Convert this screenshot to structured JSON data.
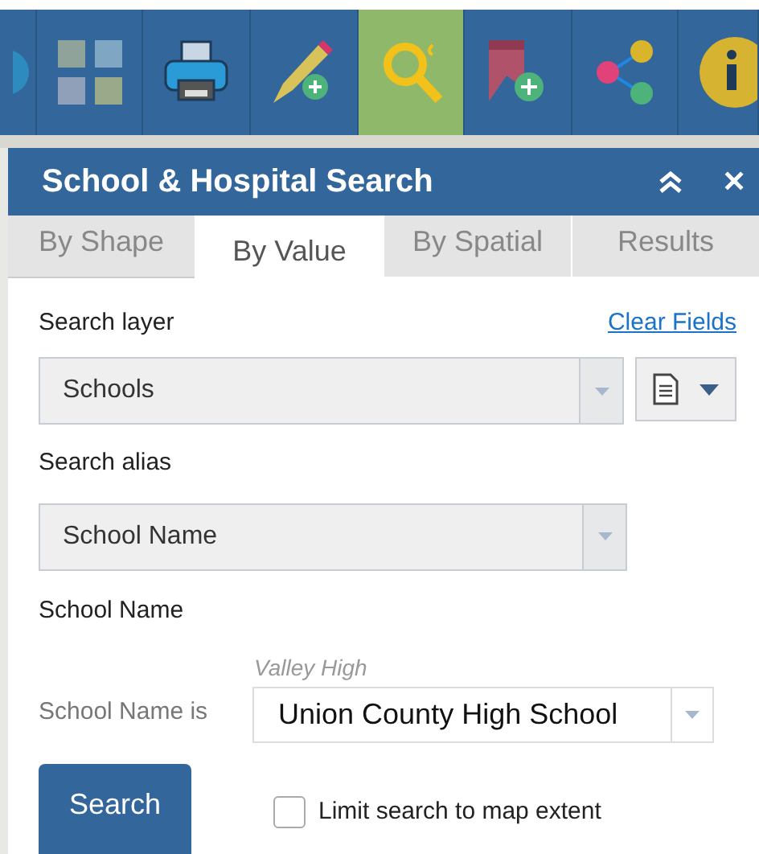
{
  "toolbar": {
    "buttons": [
      {
        "kind": "globe",
        "selected": false
      },
      {
        "kind": "basemaps",
        "selected": false
      },
      {
        "kind": "print",
        "selected": false
      },
      {
        "kind": "draw",
        "selected": false
      },
      {
        "kind": "search",
        "selected": true
      },
      {
        "kind": "bookmark",
        "selected": false
      },
      {
        "kind": "share",
        "selected": false
      },
      {
        "kind": "info",
        "selected": false
      }
    ]
  },
  "panel": {
    "title": "School & Hospital Search",
    "close_icon": "✕"
  },
  "tabs": [
    {
      "label": "By Shape",
      "selected": false
    },
    {
      "label": "By Value",
      "selected": true
    },
    {
      "label": "By Spatial",
      "selected": false
    },
    {
      "label": "Results",
      "selected": false
    }
  ],
  "form": {
    "search_layer_label": "Search layer",
    "clear_fields": "Clear Fields",
    "search_layer_value": "Schools",
    "search_alias_label": "Search alias",
    "search_alias_value": "School Name",
    "section_label": "School Name",
    "hint": "Valley High",
    "expression_label": "School Name is",
    "expression_value": "Union County High School",
    "search_button": "Search",
    "limit_checkbox": {
      "label": "Limit search to map extent",
      "checked": false
    }
  }
}
